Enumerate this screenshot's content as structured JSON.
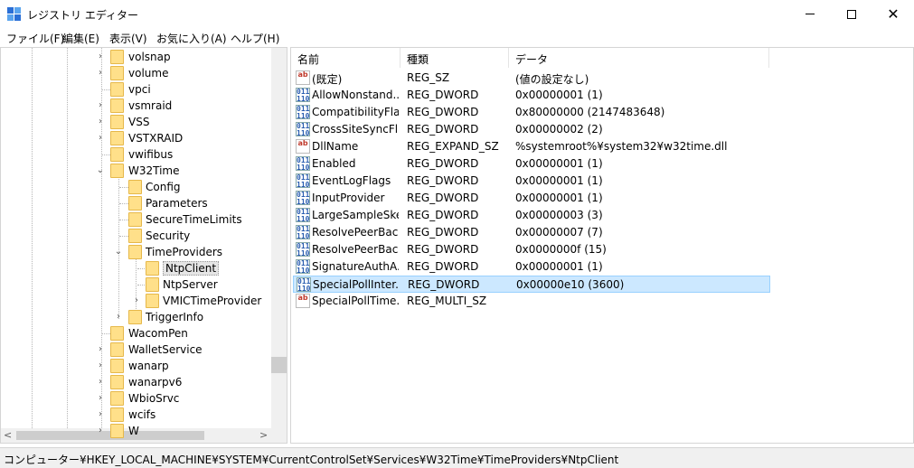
{
  "window": {
    "title": "レジストリ エディター",
    "minimize_icon": "minimize-icon",
    "maximize_icon": "maximize-icon",
    "close_glyph": "✕"
  },
  "menu": [
    {
      "label": "ファイル(F)"
    },
    {
      "label": "編集(E)"
    },
    {
      "label": "表示(V)"
    },
    {
      "label": "お気に入り(A)"
    },
    {
      "label": "ヘルプ(H)"
    }
  ],
  "tree": {
    "items": [
      {
        "label": "volsnap",
        "level": 0,
        "expander": ">",
        "selected": false
      },
      {
        "label": "volume",
        "level": 0,
        "expander": ">",
        "selected": false
      },
      {
        "label": "vpci",
        "level": 0,
        "expander": "",
        "selected": false
      },
      {
        "label": "vsmraid",
        "level": 0,
        "expander": ">",
        "selected": false
      },
      {
        "label": "VSS",
        "level": 0,
        "expander": ">",
        "selected": false
      },
      {
        "label": "VSTXRAID",
        "level": 0,
        "expander": ">",
        "selected": false
      },
      {
        "label": "vwifibus",
        "level": 0,
        "expander": "",
        "selected": false
      },
      {
        "label": "W32Time",
        "level": 0,
        "expander": "v",
        "selected": false
      },
      {
        "label": "Config",
        "level": 1,
        "expander": "",
        "selected": false
      },
      {
        "label": "Parameters",
        "level": 1,
        "expander": "",
        "selected": false
      },
      {
        "label": "SecureTimeLimits",
        "level": 1,
        "expander": "",
        "selected": false
      },
      {
        "label": "Security",
        "level": 1,
        "expander": "",
        "selected": false
      },
      {
        "label": "TimeProviders",
        "level": 1,
        "expander": "v",
        "selected": false
      },
      {
        "label": "NtpClient",
        "level": 2,
        "expander": "",
        "selected": true
      },
      {
        "label": "NtpServer",
        "level": 2,
        "expander": "",
        "selected": false
      },
      {
        "label": "VMICTimeProvider",
        "level": 2,
        "expander": ">",
        "selected": false
      },
      {
        "label": "TriggerInfo",
        "level": 1,
        "expander": ">",
        "selected": false
      },
      {
        "label": "WacomPen",
        "level": 0,
        "expander": "",
        "selected": false
      },
      {
        "label": "WalletService",
        "level": 0,
        "expander": ">",
        "selected": false
      },
      {
        "label": "wanarp",
        "level": 0,
        "expander": ">",
        "selected": false
      },
      {
        "label": "wanarpv6",
        "level": 0,
        "expander": ">",
        "selected": false
      },
      {
        "label": "WbioSrvc",
        "level": 0,
        "expander": ">",
        "selected": false
      },
      {
        "label": "wcifs",
        "level": 0,
        "expander": ">",
        "selected": false
      },
      {
        "label": "W",
        "level": 0,
        "expander": ">",
        "selected": false
      }
    ],
    "scroll_left_arrow": "<",
    "scroll_right_arrow": ">"
  },
  "list": {
    "headers": {
      "name": "名前",
      "type": "種類",
      "data": "データ"
    },
    "rows": [
      {
        "icon": "string-value-icon",
        "name": "(既定)",
        "type": "REG_SZ",
        "data": "(値の設定なし)",
        "selected": false
      },
      {
        "icon": "binary-value-icon",
        "name": "AllowNonstand...",
        "type": "REG_DWORD",
        "data": "0x00000001 (1)",
        "selected": false
      },
      {
        "icon": "binary-value-icon",
        "name": "CompatibilityFla...",
        "type": "REG_DWORD",
        "data": "0x80000000 (2147483648)",
        "selected": false
      },
      {
        "icon": "binary-value-icon",
        "name": "CrossSiteSyncFl...",
        "type": "REG_DWORD",
        "data": "0x00000002 (2)",
        "selected": false
      },
      {
        "icon": "string-value-icon",
        "name": "DllName",
        "type": "REG_EXPAND_SZ",
        "data": "%systemroot%¥system32¥w32time.dll",
        "selected": false
      },
      {
        "icon": "binary-value-icon",
        "name": "Enabled",
        "type": "REG_DWORD",
        "data": "0x00000001 (1)",
        "selected": false
      },
      {
        "icon": "binary-value-icon",
        "name": "EventLogFlags",
        "type": "REG_DWORD",
        "data": "0x00000001 (1)",
        "selected": false
      },
      {
        "icon": "binary-value-icon",
        "name": "InputProvider",
        "type": "REG_DWORD",
        "data": "0x00000001 (1)",
        "selected": false
      },
      {
        "icon": "binary-value-icon",
        "name": "LargeSampleSkew",
        "type": "REG_DWORD",
        "data": "0x00000003 (3)",
        "selected": false
      },
      {
        "icon": "binary-value-icon",
        "name": "ResolvePeerBac...",
        "type": "REG_DWORD",
        "data": "0x00000007 (7)",
        "selected": false
      },
      {
        "icon": "binary-value-icon",
        "name": "ResolvePeerBac...",
        "type": "REG_DWORD",
        "data": "0x0000000f (15)",
        "selected": false
      },
      {
        "icon": "binary-value-icon",
        "name": "SignatureAuthA...",
        "type": "REG_DWORD",
        "data": "0x00000001 (1)",
        "selected": false
      },
      {
        "icon": "binary-value-icon",
        "name": "SpecialPollInter...",
        "type": "REG_DWORD",
        "data": "0x00000e10 (3600)",
        "selected": true
      },
      {
        "icon": "string-value-icon",
        "name": "SpecialPollTime...",
        "type": "REG_MULTI_SZ",
        "data": "",
        "selected": false
      }
    ]
  },
  "statusbar": {
    "path": "コンピューター¥HKEY_LOCAL_MACHINE¥SYSTEM¥CurrentControlSet¥Services¥W32Time¥TimeProviders¥NtpClient"
  },
  "colors": {
    "selection_bg": "#cce8ff",
    "selection_border": "#99d1ff",
    "folder": "#ffe08a"
  }
}
